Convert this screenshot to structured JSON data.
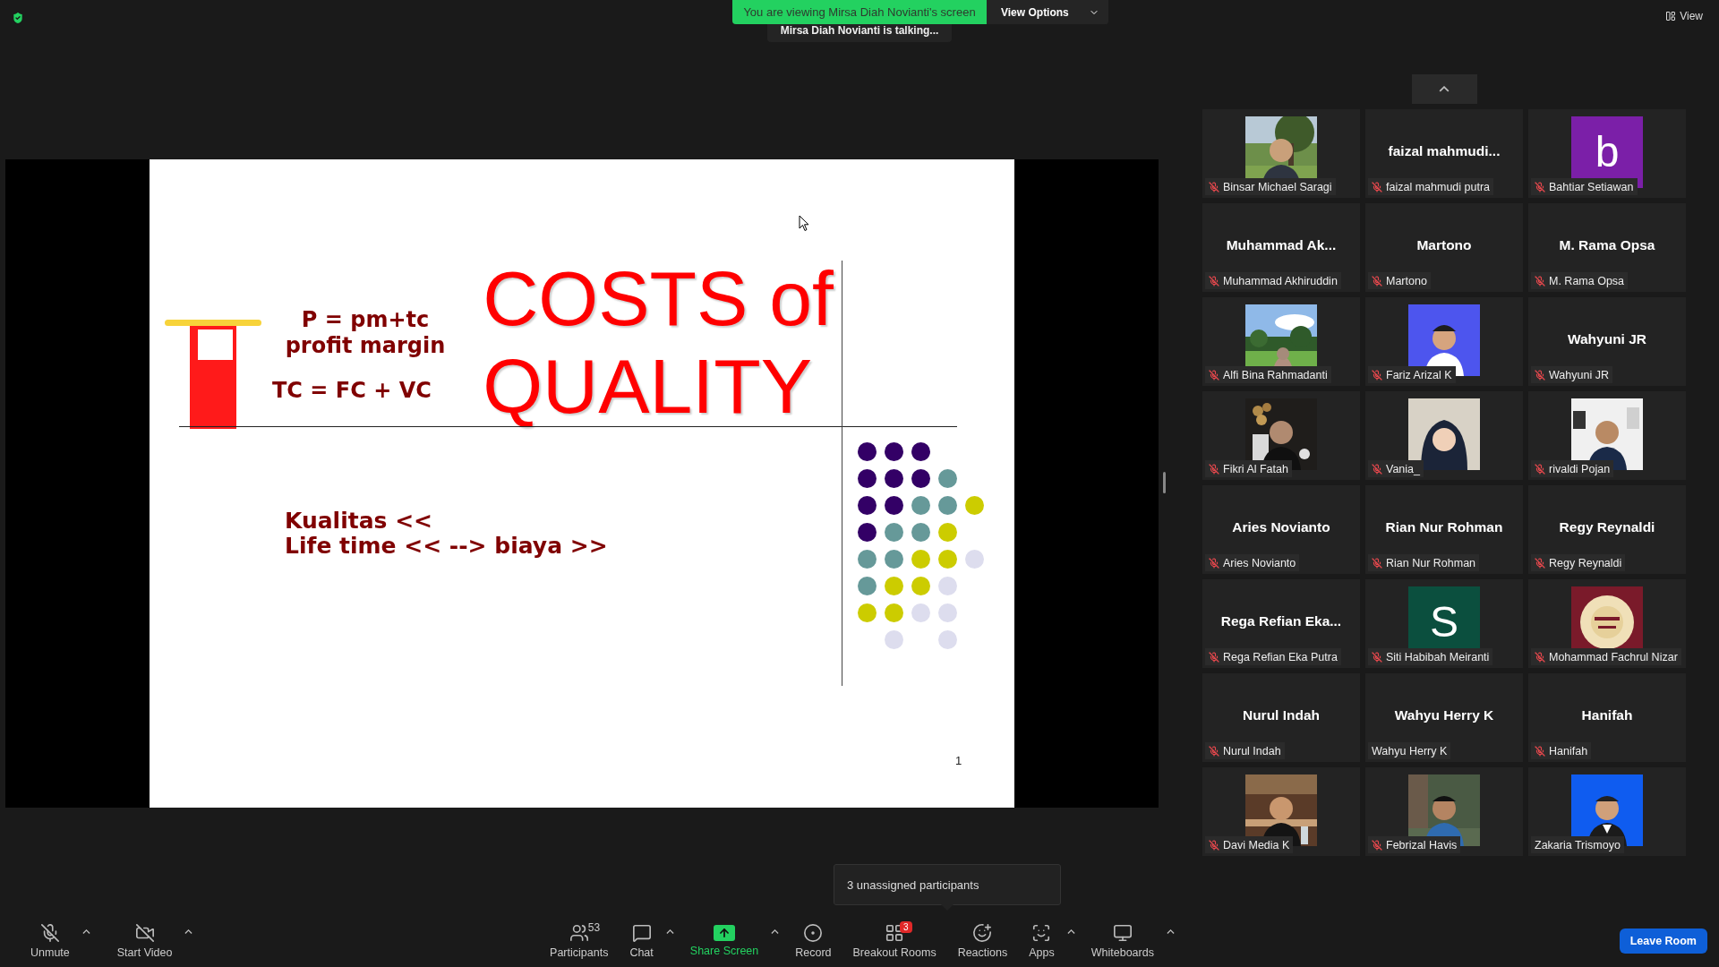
{
  "top_banner": {
    "text": "You are viewing Mirsa Diah Novianti's screen",
    "view_options": "View Options"
  },
  "speaker_indicator": "Mirsa Diah Novianti is talking...",
  "view_button": "View",
  "slide": {
    "formula_1": "P = pm+tc",
    "formula_2": "profit margin",
    "formula_3": "TC = FC + VC",
    "title_line_1": "COSTS of",
    "title_line_2": "QUALITY",
    "body_line_1": "Kualitas <<",
    "body_line_2": "Life time << --> biaya >>",
    "page_number": "1"
  },
  "participants": [
    {
      "name": "Binsar Michael Saragi",
      "muted": true
    },
    {
      "name": "faizal mahmudi putra",
      "display": "faizal mahmudi...",
      "kind": "name",
      "muted": true
    },
    {
      "name": "Bahtiar Setiawan",
      "kind": "avatar",
      "letter": "b",
      "color": "#7b1fa8",
      "muted": true
    },
    {
      "name": "Muhammad Akhiruddin",
      "display": "Muhammad Ak...",
      "kind": "name",
      "muted": true
    },
    {
      "name": "Martono",
      "display": "Martono",
      "kind": "name",
      "muted": true
    },
    {
      "name": "M. Rama Opsa",
      "display": "M. Rama Opsa",
      "kind": "name",
      "muted": true
    },
    {
      "name": "Alfi Bina Rahmadanti",
      "muted": true
    },
    {
      "name": "Fariz Arizal K",
      "muted": true
    },
    {
      "name": "Wahyuni JR",
      "display": "Wahyuni JR",
      "kind": "name",
      "muted": true
    },
    {
      "name": "Fikri Al Fatah",
      "muted": true
    },
    {
      "name": "Vania_",
      "muted": true
    },
    {
      "name": "rivaldi Pojan",
      "muted": true
    },
    {
      "name": "Aries Novianto",
      "display": "Aries Novianto",
      "kind": "name",
      "muted": true
    },
    {
      "name": "Rian Nur Rohman",
      "display": "Rian Nur Rohman",
      "kind": "name",
      "muted": true
    },
    {
      "name": "Regy Reynaldi",
      "display": "Regy Reynaldi",
      "kind": "name",
      "muted": true
    },
    {
      "name": "Rega Refian Eka Putra",
      "display": "Rega Refian Eka...",
      "kind": "name",
      "muted": true
    },
    {
      "name": "Siti Habibah Meiranti",
      "kind": "avatar",
      "letter": "S",
      "color": "#0b4f3e",
      "muted": true
    },
    {
      "name": "Mohammad Fachrul Nizar",
      "muted": true
    },
    {
      "name": "Nurul Indah",
      "display": "Nurul Indah",
      "kind": "name",
      "muted": true
    },
    {
      "name": "Wahyu Herry K",
      "display": "Wahyu Herry K",
      "kind": "name",
      "muted": false
    },
    {
      "name": "Hanifah",
      "display": "Hanifah",
      "kind": "name",
      "muted": true
    },
    {
      "name": "Davi Media K",
      "muted": true
    },
    {
      "name": "Febrizal Havis",
      "muted": true
    },
    {
      "name": "Zakaria Trismoyo",
      "muted": false
    }
  ],
  "breakout_hint": "3 unassigned participants",
  "toolbar_left": [
    {
      "label": "Unmute",
      "kind": "mic",
      "menu": true
    },
    {
      "label": "Start Video",
      "kind": "video",
      "menu": true
    }
  ],
  "toolbar_center": [
    {
      "label": "Participants",
      "kind": "participants",
      "count": "53",
      "menu": false
    },
    {
      "label": "Chat",
      "kind": "chat",
      "menu": true
    },
    {
      "label": "Share Screen",
      "kind": "share",
      "menu": true
    },
    {
      "label": "Record",
      "kind": "record",
      "menu": false
    },
    {
      "label": "Breakout Rooms",
      "kind": "breakout",
      "badge": "3",
      "menu": false
    },
    {
      "label": "Reactions",
      "kind": "reactions",
      "menu": false
    },
    {
      "label": "Apps",
      "kind": "apps",
      "menu": true
    },
    {
      "label": "Whiteboards",
      "kind": "whiteboards",
      "menu": true
    }
  ],
  "leave_button": "Leave Room"
}
